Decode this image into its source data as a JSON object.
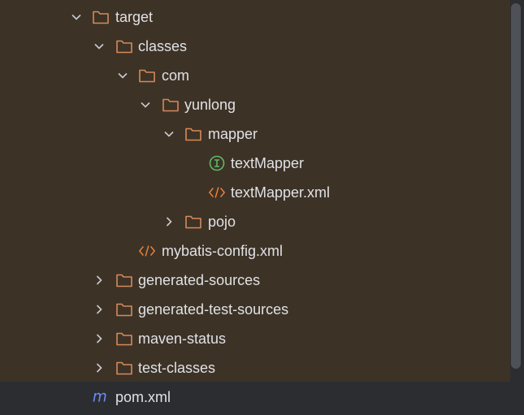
{
  "tree": {
    "items": [
      {
        "label": "target",
        "icon": "folder-icon",
        "expanded": true
      },
      {
        "label": "classes",
        "icon": "folder-icon",
        "expanded": true
      },
      {
        "label": "com",
        "icon": "folder-icon",
        "expanded": true
      },
      {
        "label": "yunlong",
        "icon": "folder-icon",
        "expanded": true
      },
      {
        "label": "mapper",
        "icon": "folder-icon",
        "expanded": true
      },
      {
        "label": "textMapper",
        "icon": "interface-icon"
      },
      {
        "label": "textMapper.xml",
        "icon": "xml-file-icon"
      },
      {
        "label": "pojo",
        "icon": "folder-icon",
        "expanded": false
      },
      {
        "label": "mybatis-config.xml",
        "icon": "xml-file-icon"
      },
      {
        "label": "generated-sources",
        "icon": "folder-icon",
        "expanded": false
      },
      {
        "label": "generated-test-sources",
        "icon": "folder-icon",
        "expanded": false
      },
      {
        "label": "maven-status",
        "icon": "folder-icon",
        "expanded": false
      },
      {
        "label": "test-classes",
        "icon": "folder-icon",
        "expanded": false
      },
      {
        "label": "pom.xml",
        "icon": "maven-icon"
      }
    ]
  },
  "colors": {
    "background": "#2b2d30",
    "excluded_highlight": "#3d3226",
    "folder_outline": "#d58a5a",
    "interface": "#5fb865",
    "xml": "#e8823a",
    "maven": "#6b8cf6",
    "text": "#dfe1e5",
    "chevron": "#c9ccd1"
  }
}
